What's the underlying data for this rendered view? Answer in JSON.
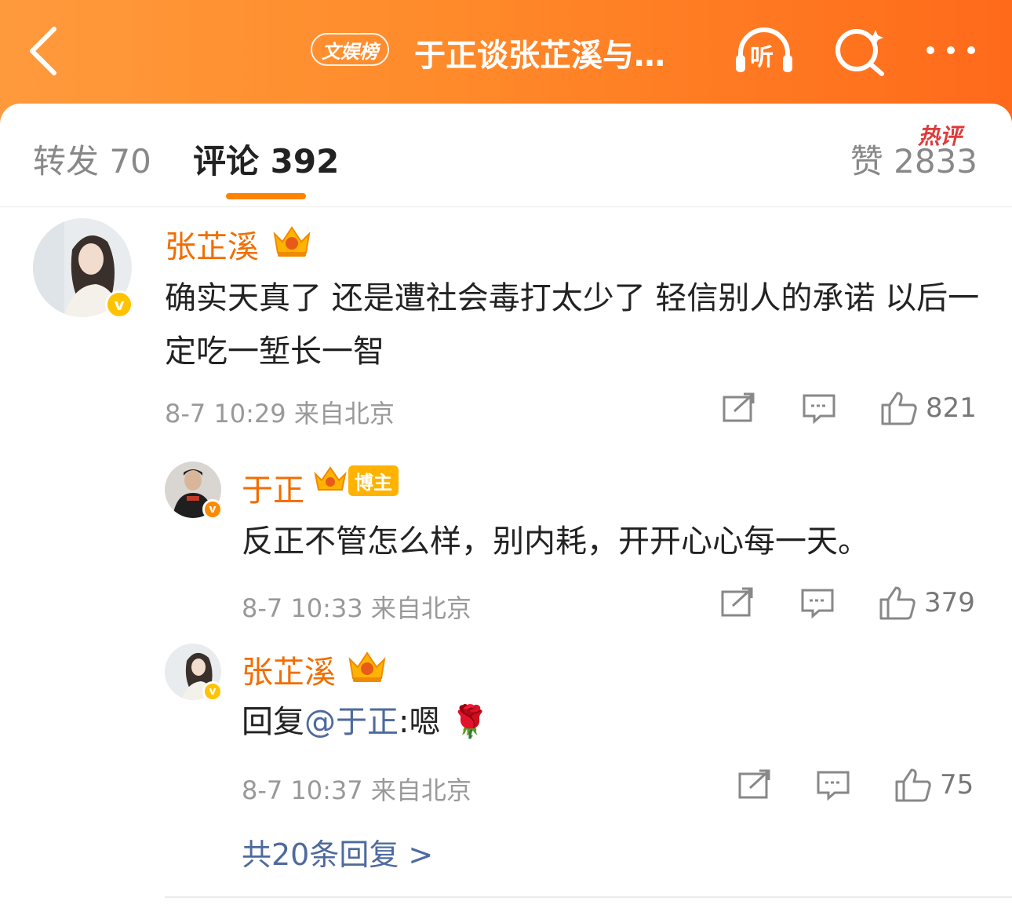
{
  "header": {
    "tag": "文娱榜",
    "title": "于正谈张芷溪与…",
    "listen_label": "听"
  },
  "tabs": {
    "repost": "转发 70",
    "comment": "评论 392",
    "like": "赞 2833"
  },
  "colors": {
    "accent": "#ff8200",
    "username": "#f26d00",
    "link": "#4e6a9e",
    "hot": "#e03a3a"
  },
  "comments": [
    {
      "user": "张芷溪",
      "hot_tag": "热评",
      "text": "确实天真了 还是遭社会毒打太少了 轻信别人的承诺 以后一定吃一堑长一智",
      "time": "8-7 10:29",
      "location": "来自北京",
      "likes": "821"
    },
    {
      "user": "于正",
      "badge": "博主",
      "text": "反正不管怎么样，别内耗，开开心心每一天。",
      "time": "8-7 10:33",
      "location": "来自北京",
      "likes": "379"
    },
    {
      "user": "张芷溪",
      "reply_prefix": "回复",
      "mention": "@于正",
      "reply_text": ":嗯",
      "emoji": "🌹",
      "time": "8-7 10:37",
      "location": "来自北京",
      "likes": "75"
    }
  ],
  "more_replies": "共20条回复 >"
}
